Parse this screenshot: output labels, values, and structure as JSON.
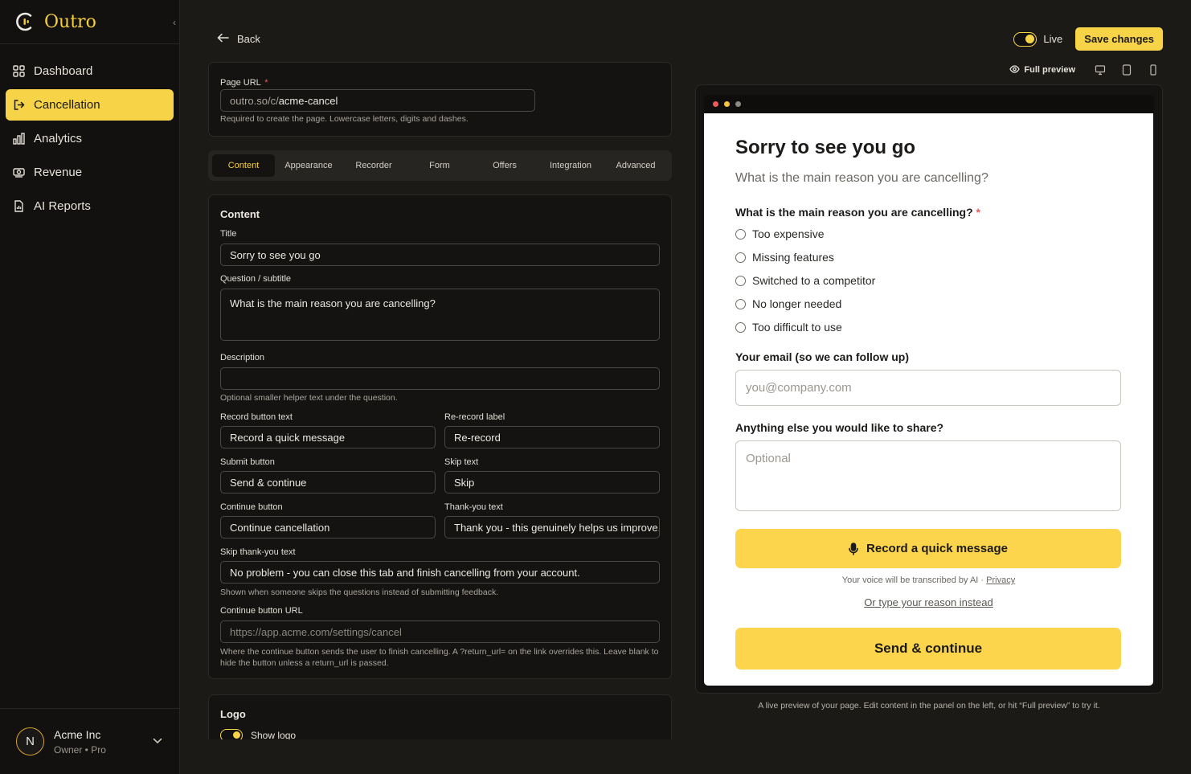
{
  "brand": {
    "name": "Outro"
  },
  "sidebar": {
    "items": [
      {
        "label": "Dashboard",
        "icon": "grid-icon"
      },
      {
        "label": "Cancellation",
        "icon": "logout-icon",
        "active": true
      },
      {
        "label": "Analytics",
        "icon": "bar-chart-icon"
      },
      {
        "label": "Revenue",
        "icon": "money-icon"
      },
      {
        "label": "AI Reports",
        "icon": "report-icon"
      }
    ]
  },
  "account": {
    "initial": "N",
    "name": "Acme Inc",
    "role": "Owner • Pro"
  },
  "header": {
    "back_label": "Back",
    "live_label": "Live",
    "save_label": "Save changes"
  },
  "url_panel": {
    "label": "Page URL",
    "prefix": "outro.so/c/",
    "value": "acme-cancel",
    "help": "Required to create the page. Lowercase letters, digits and dashes."
  },
  "tabs": [
    "Content",
    "Appearance",
    "Recorder",
    "Form",
    "Offers",
    "Integration",
    "Advanced"
  ],
  "content": {
    "section_title": "Content",
    "title_label": "Title",
    "title_value": "Sorry to see you go",
    "question_label": "Question / subtitle",
    "question_value": "What is the main reason you are cancelling?",
    "description_label": "Description",
    "description_help": "Optional smaller helper text under the question.",
    "record_label": "Record button text",
    "record_value": "Record a quick message",
    "rerecord_label": "Re-record label",
    "rerecord_value": "Re-record",
    "submit_label": "Submit button",
    "submit_value": "Send & continue",
    "skip_label": "Skip text",
    "skip_value": "Skip",
    "continue_label": "Continue button",
    "continue_value": "Continue cancellation",
    "thanks_label": "Thank-you text",
    "thanks_value": "Thank you - this genuinely helps us improve.",
    "skip_thanks_label": "Skip thank-you text",
    "skip_thanks_value": "No problem - you can close this tab and finish cancelling from your account.",
    "skip_thanks_help": "Shown when someone skips the questions instead of submitting feedback.",
    "continue_url_label": "Continue button URL",
    "continue_url_placeholder": "https://app.acme.com/settings/cancel",
    "continue_url_help": "Where the continue button sends the user to finish cancelling. A ?return_url= on the link overrides this. Leave blank to hide the button unless a return_url is passed."
  },
  "logo": {
    "section_title": "Logo",
    "show_logo_label": "Show logo"
  },
  "preview": {
    "full_preview_label": "Full preview",
    "title": "Sorry to see you go",
    "subtitle": "What is the main reason you are cancelling?",
    "question": "What is the main reason you are cancelling?",
    "options": [
      "Too expensive",
      "Missing features",
      "Switched to a competitor",
      "No longer needed",
      "Too difficult to use"
    ],
    "email_label": "Your email (so we can follow up)",
    "email_placeholder": "you@company.com",
    "share_label": "Anything else you would like to share?",
    "share_placeholder": "Optional",
    "record_button": "Record a quick message",
    "transcribe_note": "Your voice will be transcribed by AI · ",
    "privacy_link": "Privacy",
    "type_link": "Or type your reason instead",
    "send_button": "Send & continue",
    "caption": "A live preview of your page. Edit content in the panel on the left, or hit “Full preview” to try it."
  },
  "colors": {
    "accent": "#f7d447",
    "background": "#1b1a17",
    "panel": "#141312",
    "required": "#f35a5a"
  }
}
